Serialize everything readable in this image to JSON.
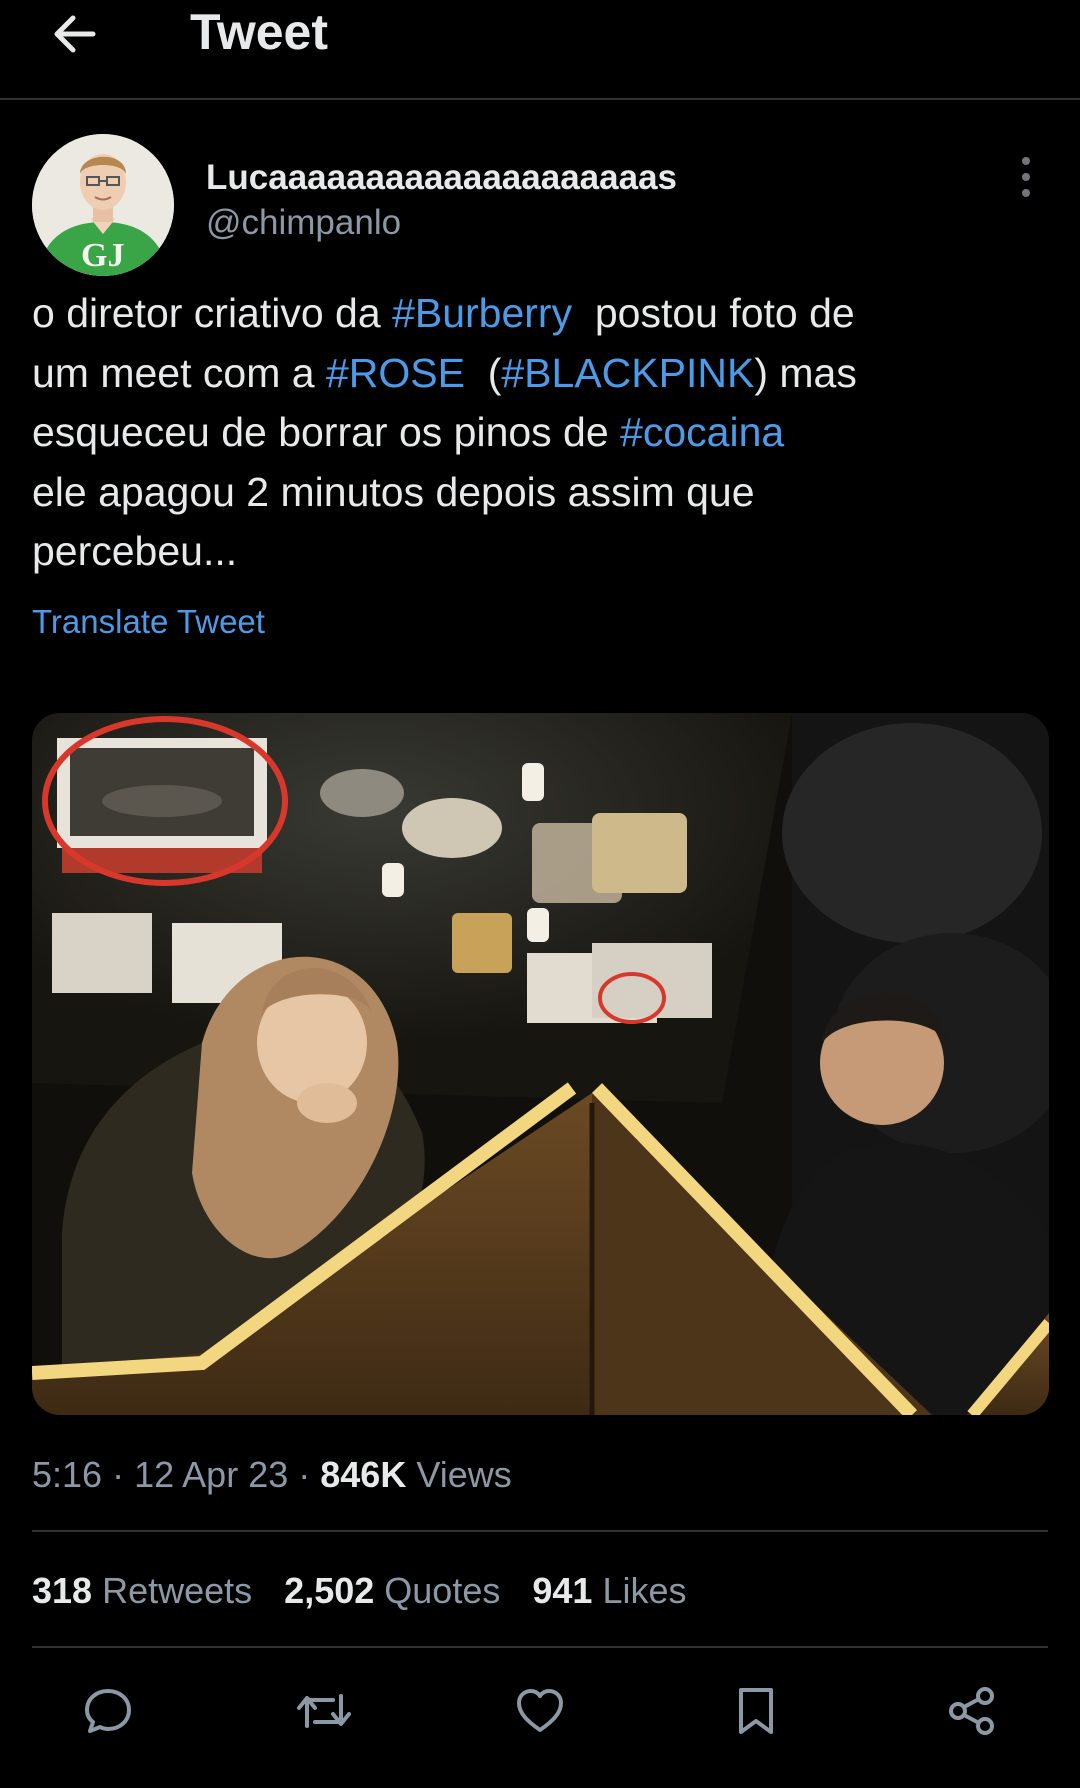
{
  "header": {
    "back_icon": "arrow-left-icon",
    "title": "Tweet"
  },
  "author": {
    "avatar_text": "GJ",
    "display_name": "Lucaaaaaaaaaaaaaaaaaaaas",
    "handle": "@chimpanlo",
    "more_icon": "more-vertical-icon"
  },
  "tweet": {
    "lines": [
      [
        {
          "text": "o diretor criativo da ",
          "tag": false
        },
        {
          "text": "#Burberry",
          "tag": true
        },
        {
          "text": "  postou foto de",
          "tag": false
        }
      ],
      [
        {
          "text": "um meet com a ",
          "tag": false
        },
        {
          "text": "#ROSE",
          "tag": true
        },
        {
          "text": "  (",
          "tag": false
        },
        {
          "text": "#BLACKPINK",
          "tag": true
        },
        {
          "text": ") mas",
          "tag": false
        }
      ],
      [
        {
          "text": "esqueceu de borrar os pinos de ",
          "tag": false
        },
        {
          "text": "#cocaina",
          "tag": true
        }
      ],
      [
        {
          "text": "ele apagou 2 minutos depois assim que",
          "tag": false
        }
      ],
      [
        {
          "text": "percebeu...",
          "tag": false
        }
      ]
    ],
    "translate_label": "Translate Tweet",
    "media_description_icon": "photo"
  },
  "meta": {
    "time": "5:16",
    "separator": "·",
    "date": "12 Apr 23",
    "views_count": "846K",
    "views_label": "Views"
  },
  "stats": {
    "retweets_count": "318",
    "retweets_label": "Retweets",
    "quotes_count": "2,502",
    "quotes_label": "Quotes",
    "likes_count": "941",
    "likes_label": "Likes"
  },
  "actions": {
    "reply_icon": "reply-icon",
    "retweet_icon": "retweet-icon",
    "like_icon": "heart-icon",
    "bookmark_icon": "bookmark-icon",
    "share_icon": "share-icon"
  },
  "colors": {
    "background": "#000000",
    "text": "#e7e9ea",
    "secondary": "#8b98a5",
    "link": "#4c9be8",
    "divider": "#2f3336"
  }
}
